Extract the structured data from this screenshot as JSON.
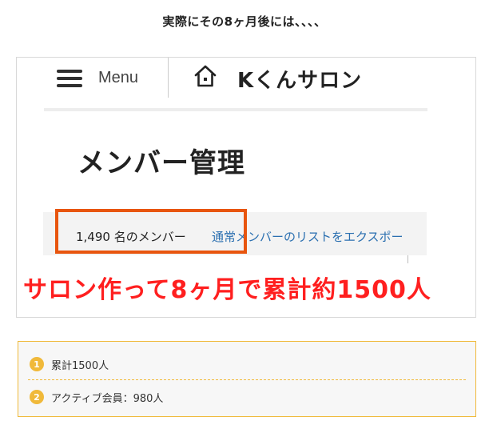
{
  "headline": "実際にその8ヶ月後には、、、、",
  "app": {
    "menu_label": "Menu",
    "salon_name": "Kくんサロン",
    "icons": {
      "menu": "hamburger-menu-icon",
      "home": "home-icon"
    }
  },
  "page": {
    "title": "メンバー管理",
    "member_count": "1,490 名のメンバー",
    "export_link": "通常メンバーのリストをエクスポー"
  },
  "overlay": {
    "caption": "サロン作って8ヶ月で累計約1500人",
    "caption_color": "#ff1f1f",
    "highlight_color": "#e8550e"
  },
  "notes": [
    {
      "number": "1",
      "text": "累計1500人"
    },
    {
      "number": "2",
      "text": "アクティブ会員：980人"
    }
  ],
  "colors": {
    "note_accent": "#f0b93a",
    "link": "#2a6fb0"
  }
}
